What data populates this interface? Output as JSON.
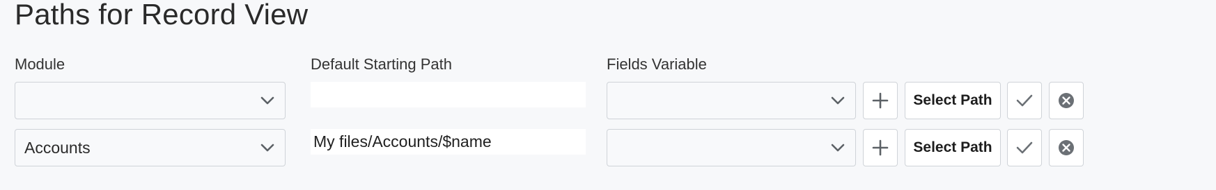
{
  "page": {
    "title": "Paths for Record View"
  },
  "columns": {
    "module": "Module",
    "default_path": "Default Starting Path",
    "fields_variable": "Fields Variable"
  },
  "rows": [
    {
      "module": "",
      "default_path": "",
      "fields_variable": "",
      "select_path_label": "Select Path"
    },
    {
      "module": "Accounts",
      "default_path": "My files/Accounts/$name",
      "fields_variable": "",
      "select_path_label": "Select Path"
    }
  ],
  "icons": {
    "dropdown": "chevron-down-icon",
    "add": "plus-icon",
    "confirm": "check-icon",
    "remove": "close-circle-icon"
  },
  "colors": {
    "background": "#f7f8fa",
    "border": "#cfd3d8",
    "icon": "#6b7075"
  }
}
